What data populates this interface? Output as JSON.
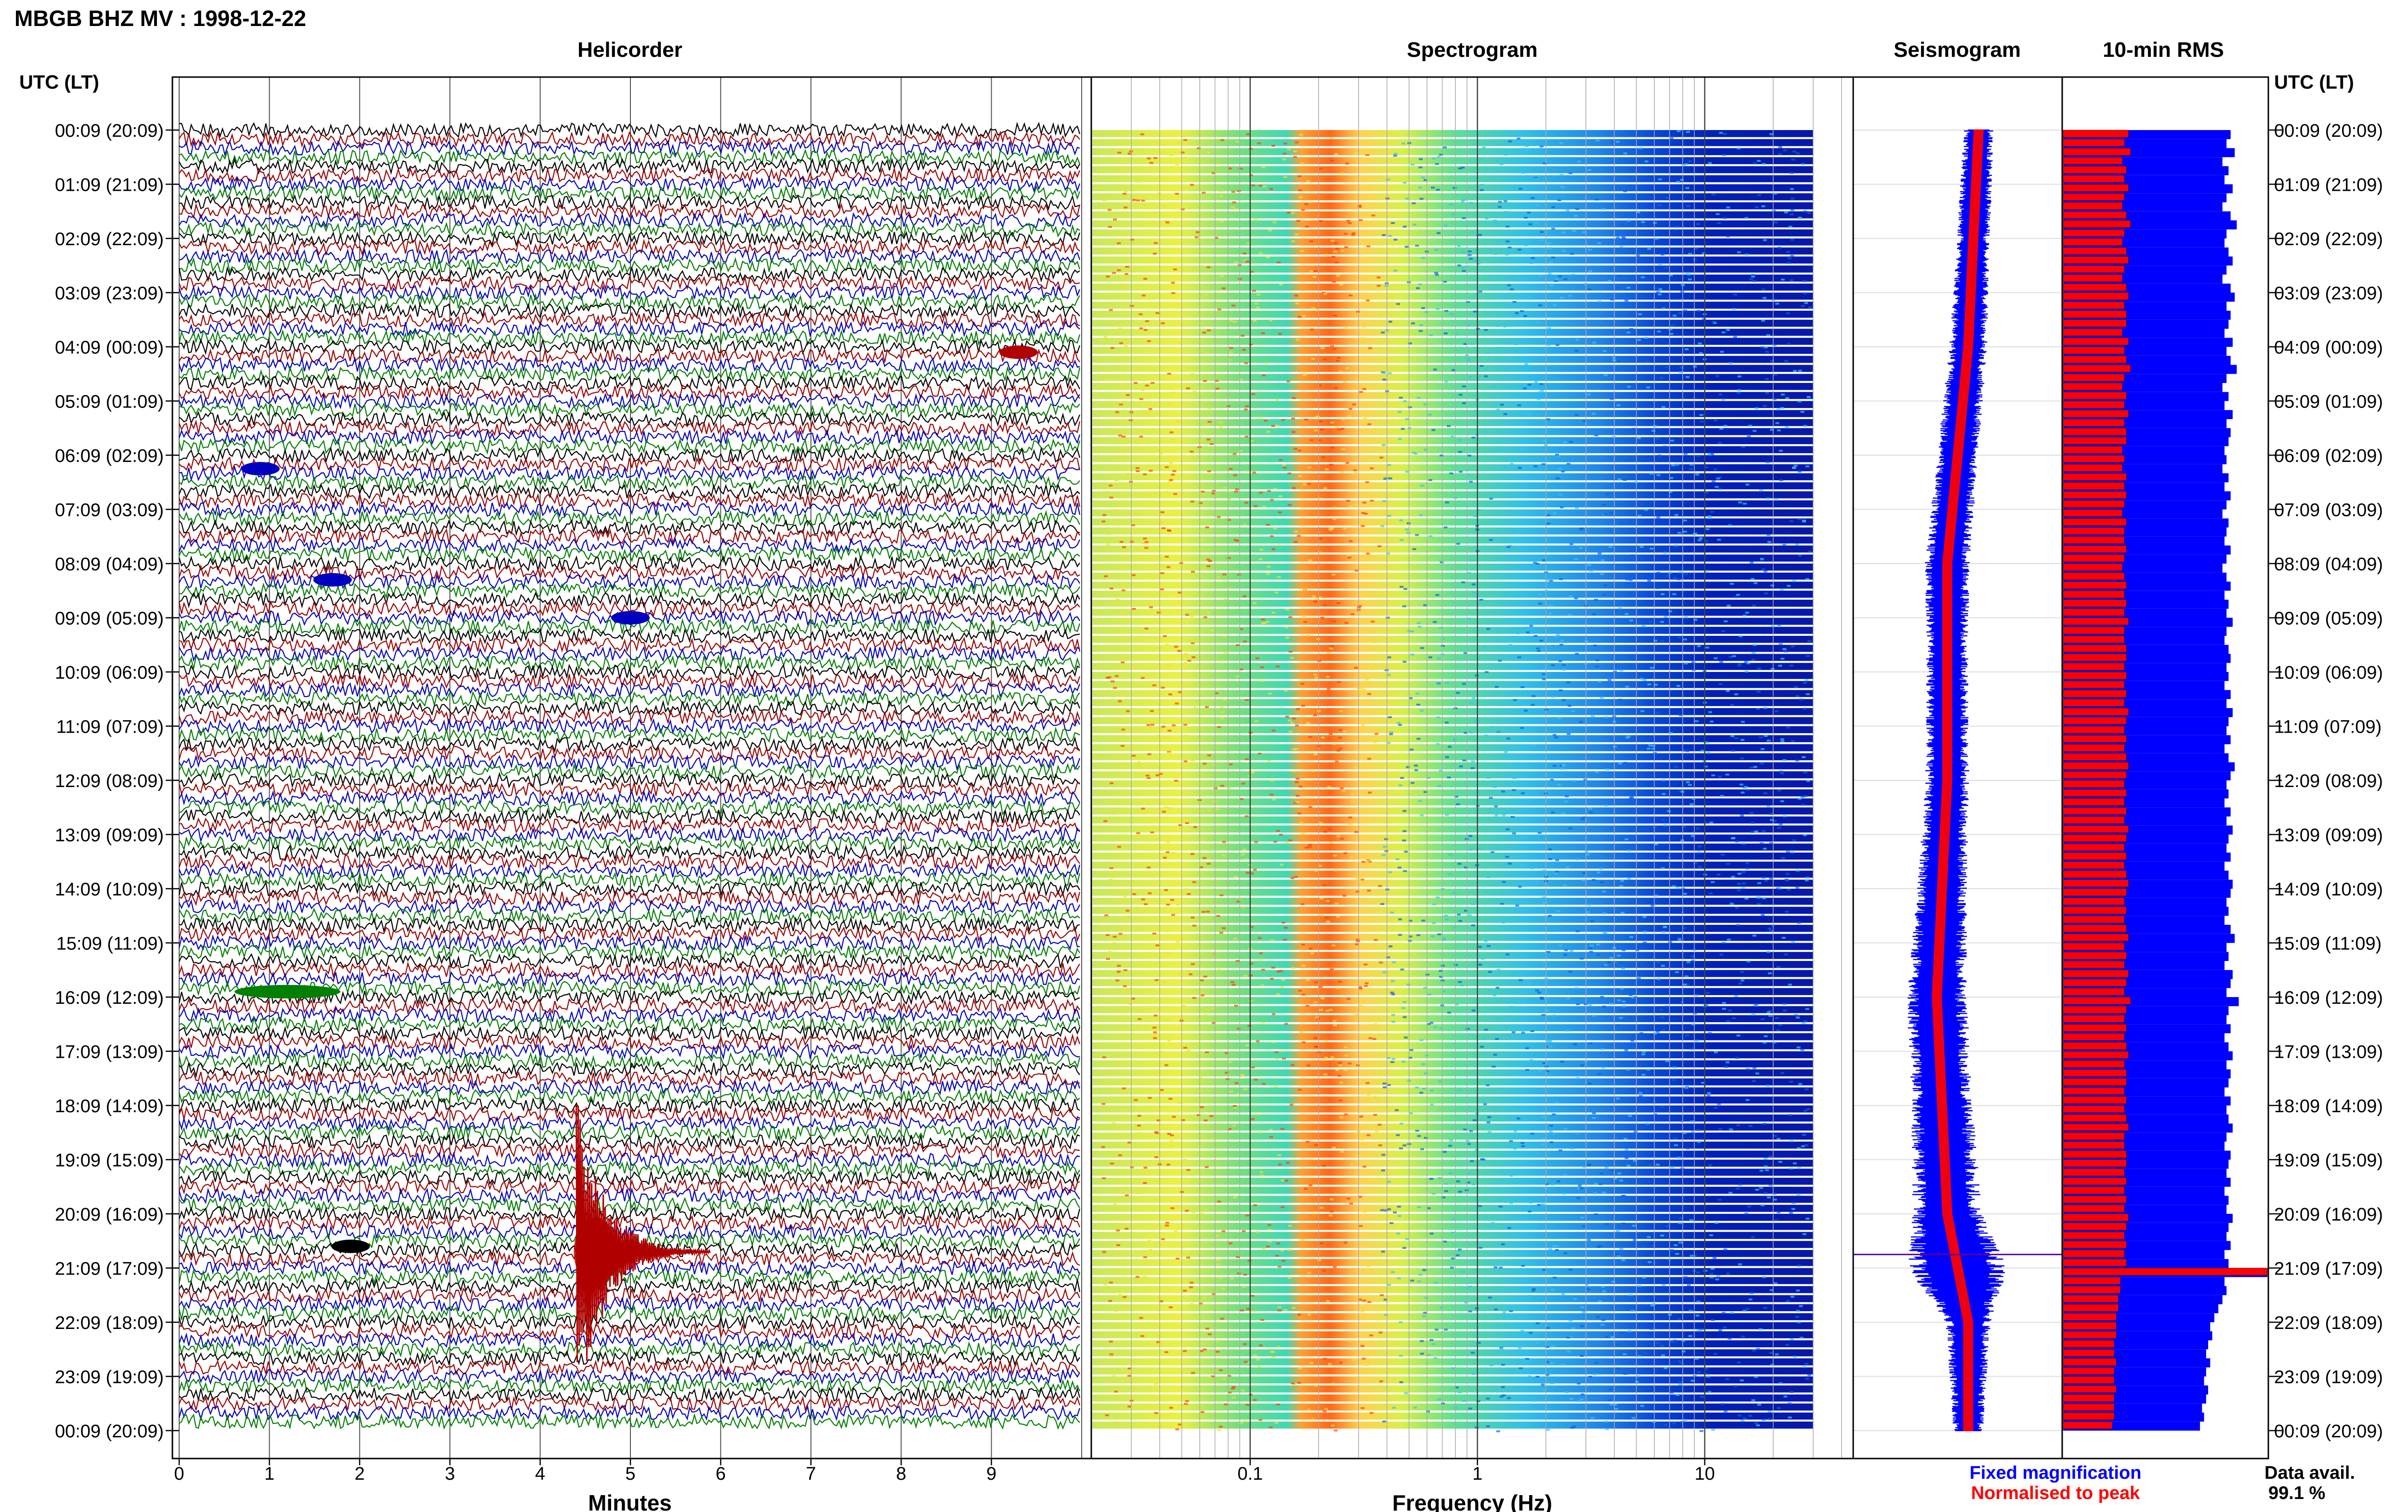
{
  "header": {
    "title": "MBGB BHZ MV : 1998-12-22"
  },
  "panels": {
    "helicorder": "Helicorder",
    "spectrogram": "Spectrogram",
    "seismogram": "Seismogram",
    "rms": "10-min RMS"
  },
  "axis_labels": {
    "left_time": "UTC (LT)",
    "right_time": "UTC (LT)",
    "helicorder_x": "Minutes",
    "spectrogram_x": "Frequency (Hz)"
  },
  "time_ticks": [
    "00:09 (20:09)",
    "01:09 (21:09)",
    "02:09 (22:09)",
    "03:09 (23:09)",
    "04:09 (00:09)",
    "05:09 (01:09)",
    "06:09 (02:09)",
    "07:09 (03:09)",
    "08:09 (04:09)",
    "09:09 (05:09)",
    "10:09 (06:09)",
    "11:09 (07:09)",
    "12:09 (08:09)",
    "13:09 (09:09)",
    "14:09 (10:09)",
    "15:09 (11:09)",
    "16:09 (12:09)",
    "17:09 (13:09)",
    "18:09 (14:09)",
    "19:09 (15:09)",
    "20:09 (16:09)",
    "21:09 (17:09)",
    "22:09 (18:09)",
    "23:09 (19:09)",
    "00:09 (20:09)"
  ],
  "minute_ticks": [
    "0",
    "1",
    "2",
    "3",
    "4",
    "5",
    "6",
    "7",
    "8",
    "9"
  ],
  "freq_ticks": [
    "0.1",
    "1",
    "10"
  ],
  "legend": {
    "fixed": "Fixed magnification",
    "normalised": "Normalised to peak",
    "colors": {
      "fixed": "#0000ff",
      "normalised": "#ff0000"
    }
  },
  "data_avail": {
    "label": "Data avail.",
    "value": "99.1 %"
  },
  "chart_data": [
    {
      "type": "line",
      "title": "Helicorder",
      "xlabel": "Minutes",
      "xlim": [
        0,
        10
      ],
      "rows": 144,
      "trace_colors": [
        "#000000",
        "#a00000",
        "#0000c0",
        "#008000"
      ],
      "events": [
        {
          "hour": 4.1,
          "minute": 9.3,
          "color": "red"
        },
        {
          "hour": 6.25,
          "minute": 0.9,
          "color": "blue"
        },
        {
          "hour": 8.3,
          "minute": 1.7,
          "color": "blue"
        },
        {
          "hour": 9.0,
          "minute": 5.0,
          "color": "blue"
        },
        {
          "hour": 15.9,
          "minute": 1.2,
          "color": "green"
        },
        {
          "hour": 20.6,
          "minute": 1.9,
          "color": "black"
        },
        {
          "hour": 20.7,
          "minute": 4.4,
          "color": "red",
          "large": true
        }
      ]
    },
    {
      "type": "heatmap",
      "title": "Spectrogram",
      "xlabel": "Frequency (Hz)",
      "xscale": "log",
      "xlim": [
        0.02,
        45
      ],
      "data_until_hz": 30,
      "peak_band_hz": [
        0.18,
        0.45
      ],
      "colormap": "jet"
    },
    {
      "type": "area",
      "title": "Seismogram",
      "series": [
        {
          "name": "Fixed magnification",
          "color": "#0000ff",
          "hours": [
            0,
            2,
            4,
            6,
            8,
            10,
            12,
            14,
            16,
            18,
            20,
            21,
            22,
            24
          ],
          "amplitude": [
            0.3,
            0.34,
            0.38,
            0.42,
            0.45,
            0.42,
            0.44,
            0.5,
            0.6,
            0.62,
            0.7,
            1.0,
            0.45,
            0.3
          ]
        },
        {
          "name": "Normalised to peak",
          "color": "#ff0000",
          "hours": [
            0,
            12,
            24
          ],
          "amplitude": [
            0.12,
            0.12,
            0.12
          ]
        }
      ],
      "center_drift_hours": [
        0,
        4,
        8,
        12,
        16,
        20,
        21,
        22,
        24
      ],
      "center_drift": [
        0.6,
        0.55,
        0.45,
        0.45,
        0.4,
        0.45,
        0.5,
        0.55,
        0.55
      ]
    },
    {
      "type": "bar",
      "title": "10-min RMS",
      "orientation": "horizontal",
      "bins": 144,
      "series": [
        {
          "name": "Fixed magnification",
          "color": "#0000ff",
          "values": [
            0.82,
            0.8,
            0.84,
            0.78,
            0.81,
            0.79,
            0.83,
            0.8,
            0.78,
            0.82,
            0.85,
            0.8,
            0.79,
            0.81,
            0.83,
            0.8,
            0.78,
            0.82,
            0.84,
            0.8,
            0.82,
            0.81,
            0.79,
            0.83,
            0.8,
            0.82,
            0.85,
            0.8,
            0.78,
            0.81,
            0.79,
            0.83,
            0.8,
            0.82,
            0.81,
            0.79,
            0.8,
            0.78,
            0.81,
            0.79,
            0.82,
            0.8,
            0.78,
            0.81,
            0.8,
            0.79,
            0.82,
            0.8,
            0.78,
            0.8,
            0.82,
            0.79,
            0.81,
            0.8,
            0.83,
            0.8,
            0.79,
            0.81,
            0.82,
            0.8,
            0.81,
            0.79,
            0.82,
            0.8,
            0.83,
            0.81,
            0.8,
            0.82,
            0.79,
            0.81,
            0.84,
            0.82,
            0.8,
            0.81,
            0.79,
            0.82,
            0.8,
            0.83,
            0.81,
            0.8,
            0.82,
            0.79,
            0.81,
            0.83,
            0.82,
            0.8,
            0.81,
            0.79,
            0.82,
            0.84,
            0.8,
            0.81,
            0.79,
            0.83,
            0.82,
            0.8,
            0.86,
            0.81,
            0.8,
            0.82,
            0.79,
            0.81,
            0.83,
            0.8,
            0.82,
            0.81,
            0.79,
            0.82,
            0.8,
            0.81,
            0.83,
            0.8,
            0.79,
            0.82,
            0.81,
            0.8,
            0.82,
            0.79,
            0.81,
            0.8,
            0.83,
            0.81,
            0.8,
            0.82,
            0.79,
            0.81,
            1.0,
            0.79,
            0.8,
            0.78,
            0.76,
            0.74,
            0.72,
            0.73,
            0.71,
            0.7,
            0.72,
            0.7,
            0.69,
            0.71,
            0.7,
            0.68,
            0.69,
            0.67
          ]
        },
        {
          "name": "Normalised to peak",
          "color": "#ff0000",
          "values": [
            0.32,
            0.3,
            0.33,
            0.29,
            0.31,
            0.3,
            0.32,
            0.3,
            0.29,
            0.31,
            0.33,
            0.3,
            0.29,
            0.31,
            0.32,
            0.3,
            0.29,
            0.31,
            0.32,
            0.3,
            0.31,
            0.31,
            0.29,
            0.32,
            0.3,
            0.31,
            0.33,
            0.3,
            0.29,
            0.31,
            0.3,
            0.32,
            0.3,
            0.31,
            0.31,
            0.29,
            0.3,
            0.29,
            0.31,
            0.3,
            0.31,
            0.3,
            0.29,
            0.31,
            0.3,
            0.3,
            0.31,
            0.3,
            0.29,
            0.3,
            0.31,
            0.3,
            0.31,
            0.3,
            0.32,
            0.3,
            0.3,
            0.31,
            0.31,
            0.3,
            0.31,
            0.3,
            0.31,
            0.3,
            0.32,
            0.31,
            0.3,
            0.31,
            0.3,
            0.31,
            0.32,
            0.31,
            0.3,
            0.31,
            0.3,
            0.31,
            0.3,
            0.32,
            0.31,
            0.3,
            0.31,
            0.3,
            0.31,
            0.32,
            0.31,
            0.3,
            0.31,
            0.3,
            0.31,
            0.32,
            0.3,
            0.31,
            0.3,
            0.32,
            0.31,
            0.3,
            0.33,
            0.31,
            0.3,
            0.31,
            0.3,
            0.31,
            0.32,
            0.3,
            0.31,
            0.31,
            0.3,
            0.31,
            0.3,
            0.31,
            0.32,
            0.3,
            0.3,
            0.31,
            0.31,
            0.3,
            0.31,
            0.3,
            0.31,
            0.3,
            0.32,
            0.31,
            0.3,
            0.31,
            0.3,
            0.31,
            1.0,
            0.28,
            0.28,
            0.27,
            0.27,
            0.26,
            0.26,
            0.26,
            0.25,
            0.25,
            0.26,
            0.25,
            0.25,
            0.26,
            0.25,
            0.25,
            0.25,
            0.24
          ]
        }
      ]
    }
  ]
}
